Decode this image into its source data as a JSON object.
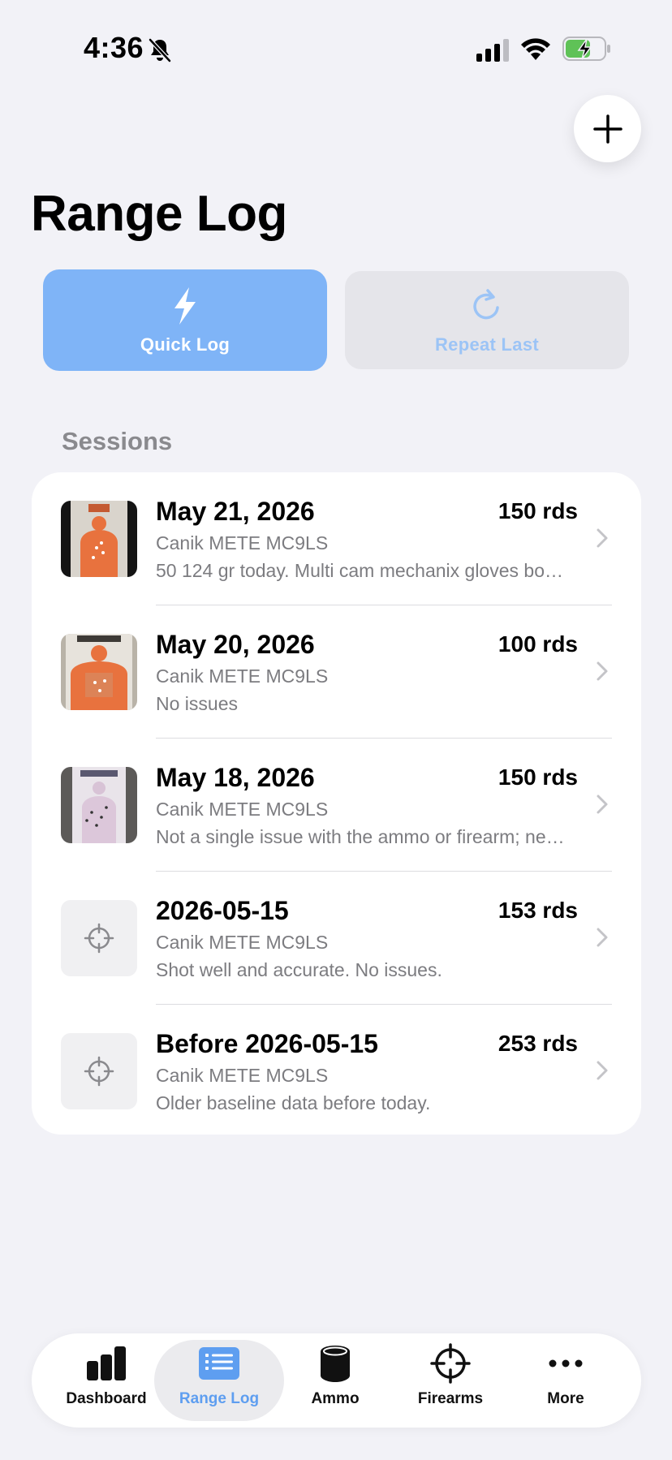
{
  "status_bar": {
    "time": "4:36",
    "icons": [
      "bell-slash-icon",
      "cellular-signal-icon",
      "wifi-icon",
      "battery-charging-icon"
    ]
  },
  "header": {
    "title": "Range Log",
    "add_icon": "plus-icon"
  },
  "actions": [
    {
      "label": "Quick Log",
      "icon": "bolt-icon",
      "enabled": true
    },
    {
      "label": "Repeat Last",
      "icon": "arrow-clockwise-icon",
      "enabled": false
    }
  ],
  "sessions": {
    "header": "Sessions",
    "items": [
      {
        "title": "May 21, 2026",
        "rounds": "150 rds",
        "firearm": "Canik METE MC9LS",
        "note": "50 124 gr today. Multi cam mechanix gloves bo…",
        "thumbnail": "target-photo"
      },
      {
        "title": "May 20, 2026",
        "rounds": "100 rds",
        "firearm": "Canik METE MC9LS",
        "note": "No issues",
        "thumbnail": "target-photo"
      },
      {
        "title": "May 18, 2026",
        "rounds": "150 rds",
        "firearm": "Canik METE MC9LS",
        "note": "Not a single issue with the ammo or firearm; ne…",
        "thumbnail": "target-photo"
      },
      {
        "title": "2026-05-15",
        "rounds": "153 rds",
        "firearm": "Canik METE MC9LS",
        "note": "Shot well and accurate. No issues.",
        "thumbnail": "crosshair-icon"
      },
      {
        "title": "Before 2026-05-15",
        "rounds": "253 rds",
        "firearm": "Canik METE MC9LS",
        "note": "Older baseline data before today.",
        "thumbnail": "crosshair-icon"
      }
    ]
  },
  "tab_bar": {
    "active": "Range Log",
    "tabs": [
      {
        "label": "Dashboard",
        "icon": "chart-bar-icon"
      },
      {
        "label": "Range Log",
        "icon": "list-icon"
      },
      {
        "label": "Ammo",
        "icon": "cylinder-icon"
      },
      {
        "label": "Firearms",
        "icon": "scope-icon"
      },
      {
        "label": "More",
        "icon": "ellipsis-icon"
      }
    ]
  },
  "colors": {
    "background": "#f2f2f7",
    "accent": "#5e9ef0",
    "quick_log_fill": "#7fb4f7",
    "secondary_text": "#7c7c80"
  }
}
